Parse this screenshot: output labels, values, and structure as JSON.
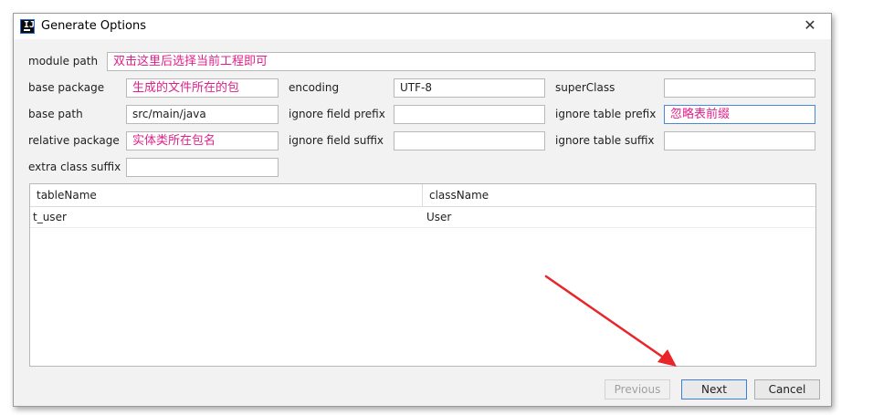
{
  "window": {
    "title": "Generate Options",
    "icon": "intellij-idea-icon",
    "close_glyph": "✕"
  },
  "module_path": {
    "label": "module path",
    "value": "双击这里后选择当前工程即可"
  },
  "col1": {
    "base_package": {
      "label": "base package",
      "value": "生成的文件所在的包"
    },
    "base_path": {
      "label": "base path",
      "value": "src/main/java"
    },
    "relative_package": {
      "label": "relative package",
      "value": "实体类所在包名"
    },
    "extra_class_suffix": {
      "label": "extra class suffix",
      "value": ""
    }
  },
  "col2": {
    "encoding": {
      "label": "encoding",
      "value": "UTF-8"
    },
    "ignore_field_prefix": {
      "label": "ignore field prefix",
      "value": ""
    },
    "ignore_field_suffix": {
      "label": "ignore field suffix",
      "value": ""
    }
  },
  "col3": {
    "super_class": {
      "label": "superClass",
      "value": ""
    },
    "ignore_table_prefix": {
      "label": "ignore table prefix",
      "value": "忽略表前缀"
    },
    "ignore_table_suffix": {
      "label": "ignore table suffix",
      "value": ""
    }
  },
  "table": {
    "columns": [
      "tableName",
      "className"
    ],
    "rows": [
      [
        "t_user",
        "User"
      ]
    ]
  },
  "buttons": {
    "previous": "Previous",
    "next": "Next",
    "cancel": "Cancel"
  },
  "colors": {
    "annotation_text": "#e0208a",
    "arrow": "#e8262a",
    "focus_border": "#4a89d6"
  }
}
